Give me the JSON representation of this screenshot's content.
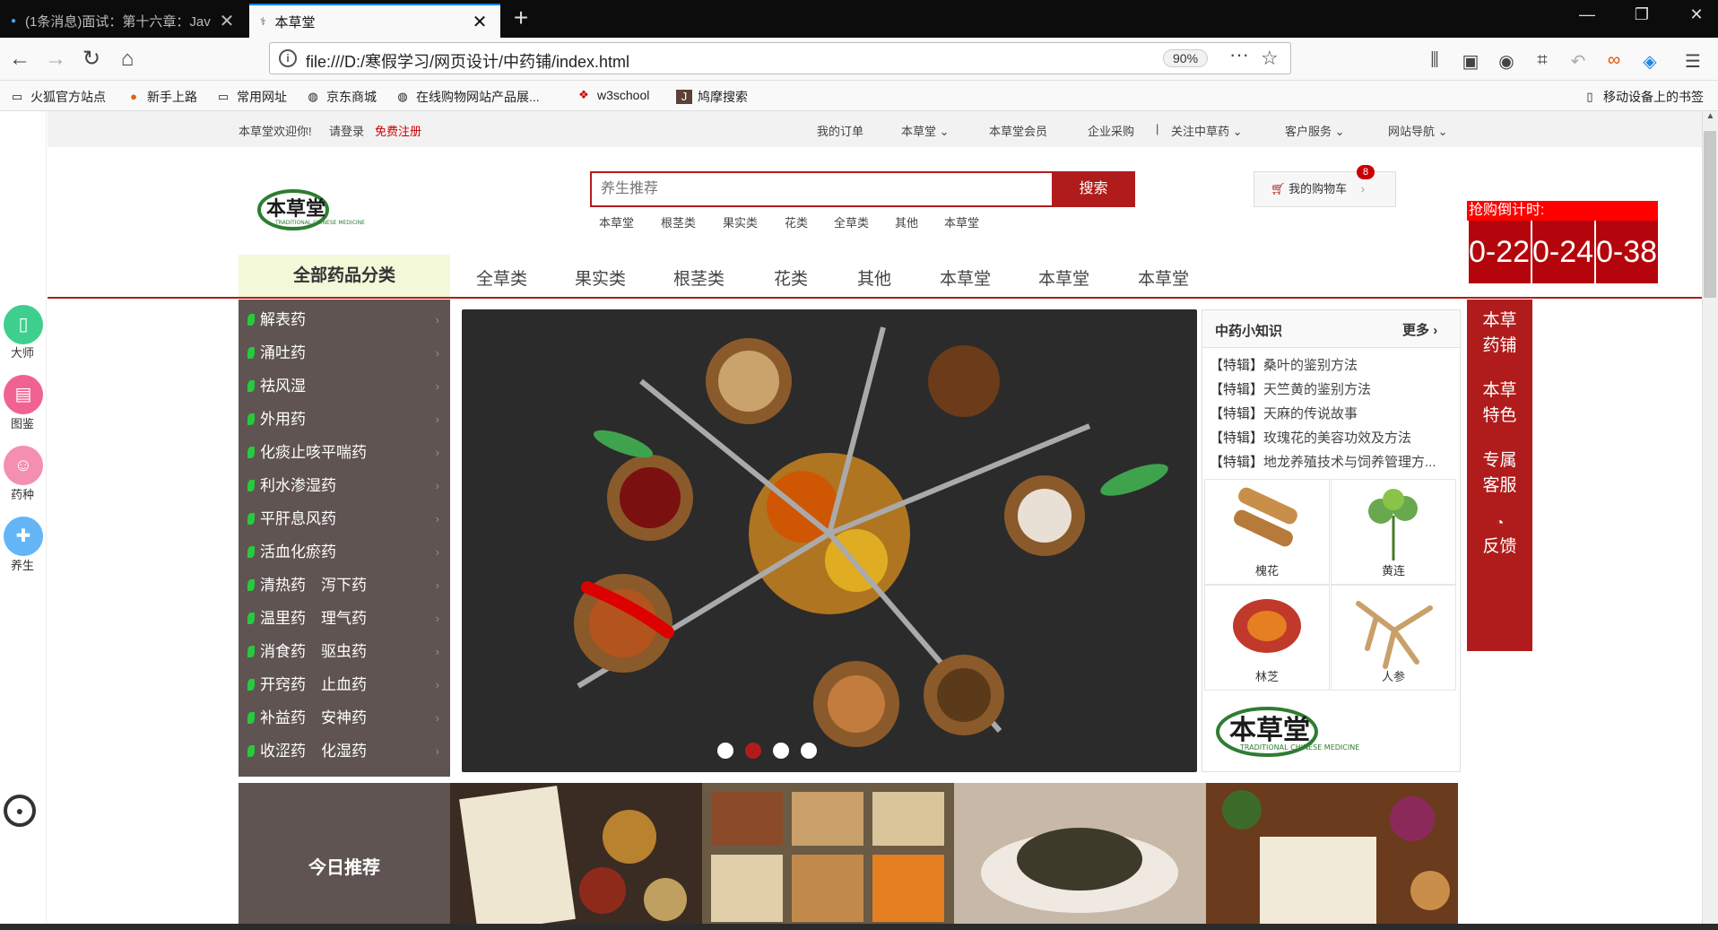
{
  "browser": {
    "tabs": [
      {
        "title": "(1条消息)面试：第十六章：Jav"
      },
      {
        "title": "本草堂"
      }
    ],
    "url": "file:///D:/寒假学习/网页设计/中药铺/index.html",
    "zoom": "90%",
    "bookmarks": [
      "火狐官方站点",
      "新手上路",
      "常用网址",
      "京东商城",
      "在线购物网站产品展...",
      "w3school",
      "鸠摩搜索"
    ],
    "mobile_bookmarks": "移动设备上的书签"
  },
  "sidebar": {
    "items": [
      {
        "label": "大师",
        "color": "#3ecf8e"
      },
      {
        "label": "图鉴",
        "color": "#f06292"
      },
      {
        "label": "药种",
        "color": "#f48fb1"
      },
      {
        "label": "养生",
        "color": "#64b5f6"
      }
    ]
  },
  "topline": {
    "welcome": "本草堂欢迎你!",
    "login": "请登录",
    "register": "免费注册",
    "links": [
      "我的订单",
      "本草堂",
      "本草堂会员",
      "企业采购",
      "关注中草药",
      "客户服务",
      "网站导航"
    ]
  },
  "search": {
    "placeholder": "养生推荐",
    "button": "搜索",
    "hot": [
      "本草堂",
      "根茎类",
      "果实类",
      "花类",
      "全草类",
      "其他",
      "本草堂"
    ]
  },
  "cart": {
    "label": "我的购物车",
    "count": "8"
  },
  "countdown": {
    "title": "抢购倒计时:",
    "cells": [
      "0-22",
      "0-24",
      "0-38"
    ]
  },
  "main_nav": {
    "category_title": "全部药品分类",
    "items": [
      "全草类",
      "果实类",
      "根茎类",
      "花类",
      "其他",
      "本草堂",
      "本草堂",
      "本草堂"
    ]
  },
  "categories": [
    "解表药",
    "涌吐药",
    "祛风湿",
    "外用药",
    "化痰止咳平喘药",
    "利水渗湿药",
    "平肝息风药",
    "活血化瘀药",
    "清热药　泻下药",
    "温里药　理气药",
    "消食药　驱虫药",
    "开窍药　止血药",
    "补益药　安神药",
    "收涩药　化湿药"
  ],
  "knowledge": {
    "title": "中药小知识",
    "more": "更多",
    "items": [
      {
        "tag": "【特辑】",
        "text": "桑叶的鉴别方法"
      },
      {
        "tag": "【特辑】",
        "text": "天竺黄的鉴别方法"
      },
      {
        "tag": "【特辑】",
        "text": "天麻的传说故事"
      },
      {
        "tag": "【特辑】",
        "text": "玫瑰花的美容功效及方法"
      },
      {
        "tag": "【特辑】",
        "text": "地龙养殖技术与饲养管理方..."
      }
    ],
    "herbs": [
      "槐花",
      "黄连",
      "林芝",
      "人参"
    ]
  },
  "right_bar": [
    "本草药铺",
    "本草特色",
    "专属客服",
    "反馈"
  ],
  "recommend": {
    "title": "今日推荐"
  },
  "logo_text": {
    "cn": "本草堂",
    "en": "TRADITIONAL CHINESE MEDICINE"
  }
}
